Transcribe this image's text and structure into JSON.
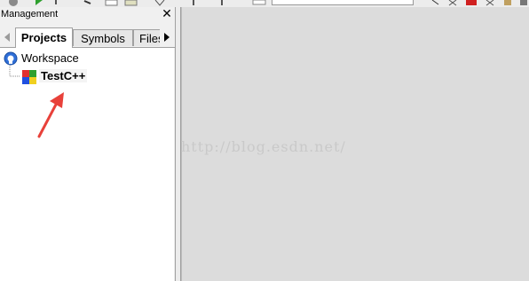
{
  "panel": {
    "title": "Management",
    "close_glyph": "✕",
    "tabs": [
      {
        "label": "Projects",
        "active": true
      },
      {
        "label": "Symbols",
        "active": false
      },
      {
        "label": "Files",
        "active": false
      }
    ]
  },
  "tree": {
    "root": {
      "label": "Workspace",
      "icon": "workspace-icon"
    },
    "children": [
      {
        "label": "TestC++",
        "icon": "project-icon"
      }
    ]
  },
  "watermark": "http://blog.esdn.net/",
  "colors": {
    "arrow": "#e8413a",
    "editor_bg": "#dcdcdc",
    "panel_bg": "#f0f0f0"
  }
}
